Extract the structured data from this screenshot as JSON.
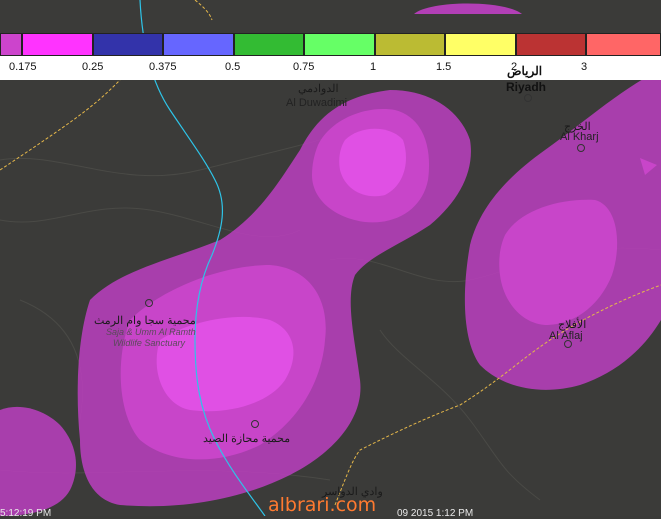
{
  "legend": {
    "swatches": [
      {
        "color": "#cc44cc"
      },
      {
        "color": "#ff33ff"
      },
      {
        "color": "#3333aa"
      },
      {
        "color": "#6666ff"
      },
      {
        "color": "#33bb33"
      },
      {
        "color": "#66ff66"
      },
      {
        "color": "#bbbb33"
      },
      {
        "color": "#ffff66"
      },
      {
        "color": "#bb3333"
      },
      {
        "color": "#ff6666"
      }
    ],
    "ticks": [
      "0.175",
      "0.25",
      "0.375",
      "0.5",
      "0.75",
      "1",
      "1.5",
      "2",
      "3"
    ]
  },
  "places": {
    "riyadh_ar": "الرياض",
    "riyadh_en": "Riyadh",
    "duwadimi_ar": "الدوادمي",
    "duwadimi_en": "Al Duwadimi",
    "kharj_ar": "الخرج",
    "kharj_en": "Al Kharj",
    "aflaj_ar": "الأفلاج",
    "aflaj_en": "Al Aflaj",
    "sanctuary_ar": "محمية سجا وام الرمث",
    "sanctuary_en_1": "Saja & Umm Al Ramth",
    "sanctuary_en_2": "Wildlife Sanctuary",
    "mahazat_ar": "محمية محازة الصيد",
    "dawasir_ar": "وادي الدواسر"
  },
  "footer": {
    "left_time": "5:12:19 PM",
    "right_time": "09 2015 1:12 PM",
    "watermark": "albrari.com"
  },
  "colors": {
    "map_bg": "#3a3a38",
    "contour_low": "#b23fb6",
    "contour_mid": "#c845c9",
    "contour_high": "#e050e4",
    "river": "#2ec4e8",
    "road": "#e6b84a"
  }
}
